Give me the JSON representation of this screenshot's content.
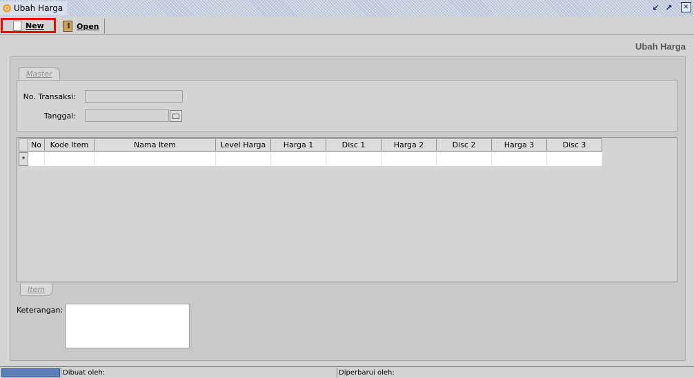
{
  "window": {
    "title": "Ubah Harga"
  },
  "toolbar": {
    "new_label": "New",
    "open_label": "Open"
  },
  "form": {
    "header": "Ubah Harga",
    "master_tab": "Master",
    "item_tab": "Item",
    "no_transaksi_label": "No. Transaksi:",
    "no_transaksi_value": "",
    "tanggal_label": "Tanggal:",
    "tanggal_value": "",
    "keterangan_label": "Keterangan:",
    "keterangan_value": ""
  },
  "grid": {
    "columns": [
      "No",
      "Kode Item",
      "Nama Item",
      "Level Harga",
      "Harga 1",
      "Disc 1",
      "Harga 2",
      "Disc 2",
      "Harga 3",
      "Disc 3"
    ],
    "new_row_marker": "*"
  },
  "status": {
    "dibuat_label": "Dibuat oleh:",
    "diperbarui_label": "Diperbarui oleh:"
  },
  "icons": {
    "app": "app-icon",
    "new": "document-icon",
    "open": "open-folder-icon",
    "calendar": "calendar-icon",
    "restore": "restore-icon",
    "maximize": "maximize-icon",
    "close": "close-icon"
  },
  "colors": {
    "highlight": "#ff0000",
    "status_accent": "#5c7fb8"
  }
}
